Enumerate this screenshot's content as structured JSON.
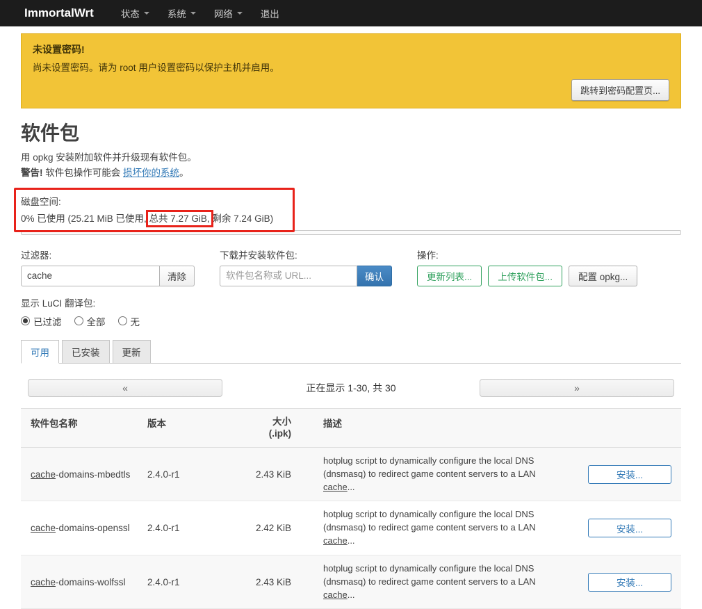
{
  "navbar": {
    "brand": "ImmortalWrt",
    "items": [
      {
        "label": "状态",
        "caret": true
      },
      {
        "label": "系统",
        "caret": true
      },
      {
        "label": "网络",
        "caret": true
      },
      {
        "label": "退出",
        "caret": false
      }
    ]
  },
  "alert": {
    "title": "未设置密码!",
    "message": "尚未设置密码。请为 root 用户设置密码以保护主机并启用。",
    "button_label": "跳转到密码配置页..."
  },
  "page": {
    "title": "软件包",
    "intro": "用 opkg 安装附加软件并升级现有软件包。",
    "warning_bold": "警告!",
    "warning_text": " 软件包操作可能会 ",
    "warning_link": "损坏你的系统",
    "warning_suffix": "。"
  },
  "disk": {
    "label": "磁盘空间:",
    "text_before": "0% 已使用 (25.21 MiB 已使用, ",
    "text_highlight": "总共 7.27 GiB,",
    "text_after": " 剩余 7.24 GiB)"
  },
  "filter": {
    "label": "过滤器:",
    "value": "cache",
    "clear_label": "清除"
  },
  "download": {
    "label": "下载并安装软件包:",
    "placeholder": "软件包名称或 URL...",
    "ok_label": "确认"
  },
  "actions": {
    "label": "操作:",
    "update_label": "更新列表...",
    "upload_label": "上传软件包...",
    "config_label": "配置 opkg..."
  },
  "translation": {
    "label": "显示 LuCI 翻译包:",
    "options": [
      {
        "label": "已过滤",
        "selected": true
      },
      {
        "label": "全部",
        "selected": false
      },
      {
        "label": "无",
        "selected": false
      }
    ]
  },
  "tabs": [
    {
      "label": "可用",
      "active": true
    },
    {
      "label": "已安装",
      "active": false
    },
    {
      "label": "更新",
      "active": false
    }
  ],
  "pagination": {
    "prev_label": "«",
    "status": "正在显示 1-30, 共 30",
    "next_label": "»"
  },
  "table": {
    "headers": {
      "name": "软件包名称",
      "version": "版本",
      "size_line1": "大小",
      "size_line2": "(.ipk)",
      "description": "描述"
    },
    "rows": [
      {
        "name_match": "cache",
        "name_rest": "-domains-mbedtls",
        "version": "2.4.0-r1",
        "size": "2.43 KiB",
        "desc_line1": "hotplug script to dynamically configure the local DNS",
        "desc_line2": "(dnsmasq) to redirect game content servers to a LAN ",
        "desc_link": "cache",
        "desc_tail": "...",
        "install_label": "安装..."
      },
      {
        "name_match": "cache",
        "name_rest": "-domains-openssl",
        "version": "2.4.0-r1",
        "size": "2.42 KiB",
        "desc_line1": "hotplug script to dynamically configure the local DNS",
        "desc_line2": "(dnsmasq) to redirect game content servers to a LAN ",
        "desc_link": "cache",
        "desc_tail": "...",
        "install_label": "安装..."
      },
      {
        "name_match": "cache",
        "name_rest": "-domains-wolfssl",
        "version": "2.4.0-r1",
        "size": "2.43 KiB",
        "desc_line1": "hotplug script to dynamically configure the local DNS",
        "desc_line2": "(dnsmasq) to redirect game content servers to a LAN ",
        "desc_link": "cache",
        "desc_tail": "...",
        "install_label": "安装..."
      }
    ]
  },
  "colors": {
    "navbar_bg": "#1c1c1c",
    "alert_bg": "#f2c437",
    "accent_blue": "#337ab7",
    "accent_green": "#2fa05c",
    "annotation_red": "#e8221a"
  }
}
